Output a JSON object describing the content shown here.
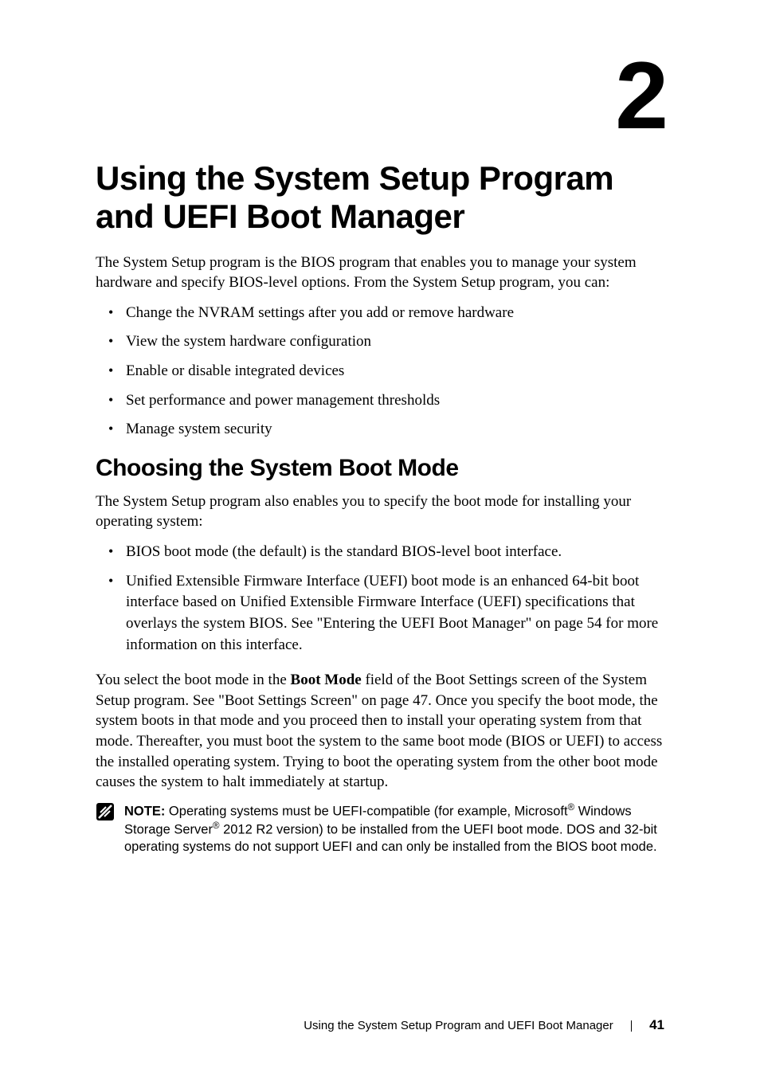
{
  "chapter": {
    "number": "2",
    "title": "Using the System Setup Program and UEFI Boot Manager",
    "intro": "The System Setup program is the BIOS program that enables you to manage your system hardware and specify BIOS-level options. From the System Setup program, you can:",
    "bullets": [
      "Change the NVRAM settings after you add or remove hardware",
      "View the system hardware configuration",
      "Enable or disable integrated devices",
      "Set performance and power management thresholds",
      "Manage system security"
    ]
  },
  "section": {
    "heading": "Choosing the System Boot Mode",
    "intro": "The System Setup program also enables you to specify the boot mode for installing your operating system:",
    "bullets": [
      "BIOS boot mode (the default) is the standard BIOS-level boot interface.",
      "Unified Extensible Firmware Interface (UEFI) boot mode is an enhanced 64-bit boot interface based on Unified Extensible Firmware Interface (UEFI) specifications that overlays the system BIOS. See \"Entering the UEFI Boot Manager\" on page 54 for more information on this interface."
    ],
    "body_pre": "You select the boot mode in the ",
    "body_bold": "Boot Mode",
    "body_post": " field of the Boot Settings screen of the System Setup program. See \"Boot Settings Screen\" on page 47. Once you specify the boot mode, the system boots in that mode and you proceed then to install your operating system from that mode. Thereafter, you must boot the system to the same boot mode (BIOS or UEFI) to access the installed operating system. Trying to boot the operating system from the other boot mode causes the system to halt immediately at startup."
  },
  "note": {
    "label": "NOTE:",
    "text_pre": " Operating systems must be UEFI-compatible (for example, Microsoft",
    "sup1": "®",
    "text_mid": " Windows Storage Server",
    "sup2": "®",
    "text_post": " 2012 R2 version) to be installed from the UEFI boot mode. DOS and 32-bit operating systems do not support UEFI and can only be installed from the BIOS boot mode."
  },
  "footer": {
    "title": "Using the System Setup Program and UEFI Boot Manager",
    "page": "41"
  }
}
